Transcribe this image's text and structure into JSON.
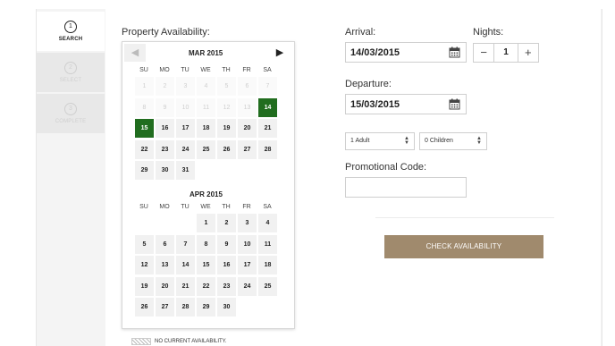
{
  "steps": [
    {
      "num": "1",
      "label": "SEARCH"
    },
    {
      "num": "2",
      "label": "SELECT"
    },
    {
      "num": "3",
      "label": "COMPLETE"
    }
  ],
  "availability": {
    "title": "Property Availability:",
    "legend": "NO CURRENT AVAILABILITY."
  },
  "calendar": {
    "dow": [
      "SU",
      "MO",
      "TU",
      "WE",
      "TH",
      "FR",
      "SA"
    ],
    "prev_glyph": "◀",
    "next_glyph": "▶",
    "months": [
      {
        "title": "MAR 2015",
        "weeks": [
          [
            "1",
            "2",
            "3",
            "4",
            "5",
            "6",
            "7"
          ],
          [
            "8",
            "9",
            "10",
            "11",
            "12",
            "13",
            "14"
          ],
          [
            "15",
            "16",
            "17",
            "18",
            "19",
            "20",
            "21"
          ],
          [
            "22",
            "23",
            "24",
            "25",
            "26",
            "27",
            "28"
          ],
          [
            "29",
            "30",
            "31",
            "",
            "",
            "",
            ""
          ]
        ],
        "past_days": [
          "1",
          "2",
          "3",
          "4",
          "5",
          "6",
          "7",
          "8",
          "9",
          "10",
          "11",
          "12",
          "13"
        ],
        "selected_days": [
          "14",
          "15"
        ]
      },
      {
        "title": "APR 2015",
        "weeks": [
          [
            "",
            "",
            "",
            "1",
            "2",
            "3",
            "4"
          ],
          [
            "5",
            "6",
            "7",
            "8",
            "9",
            "10",
            "11"
          ],
          [
            "12",
            "13",
            "14",
            "15",
            "16",
            "17",
            "18"
          ],
          [
            "19",
            "20",
            "21",
            "22",
            "23",
            "24",
            "25"
          ],
          [
            "26",
            "27",
            "28",
            "29",
            "30",
            "",
            ""
          ]
        ],
        "past_days": [],
        "selected_days": []
      }
    ]
  },
  "form": {
    "arrival_label": "Arrival:",
    "arrival_value": "14/03/2015",
    "nights_label": "Nights:",
    "nights_value": "1",
    "minus": "−",
    "plus": "+",
    "departure_label": "Departure:",
    "departure_value": "15/03/2015",
    "adults_value": "1 Adult",
    "children_value": "0 Children",
    "promo_label": "Promotional Code:",
    "promo_value": ""
  },
  "buttons": {
    "check_availability": "CHECK AVAILABILITY"
  },
  "colors": {
    "selected_day": "#216d1f",
    "primary_button": "#a08a6d"
  },
  "icons": {
    "calendar": "calendar-icon",
    "select_arrows": "updown-arrow-icon"
  }
}
